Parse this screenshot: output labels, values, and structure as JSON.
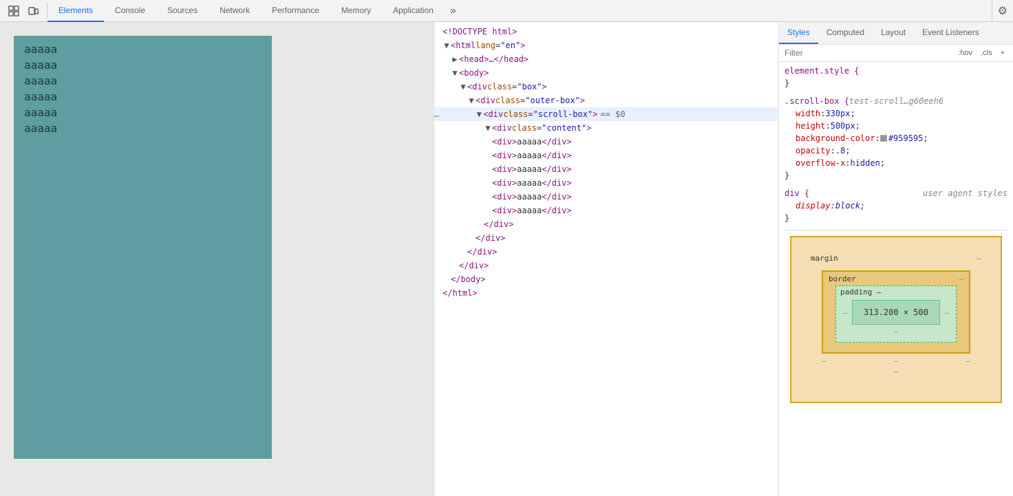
{
  "toolbar": {
    "inspect_icon": "⊹",
    "device_icon": "▭",
    "tabs": [
      {
        "id": "elements",
        "label": "Elements",
        "active": true
      },
      {
        "id": "console",
        "label": "Console",
        "active": false
      },
      {
        "id": "sources",
        "label": "Sources",
        "active": false
      },
      {
        "id": "network",
        "label": "Network",
        "active": false
      },
      {
        "id": "performance",
        "label": "Performance",
        "active": false
      },
      {
        "id": "memory",
        "label": "Memory",
        "active": false
      },
      {
        "id": "application",
        "label": "Application",
        "active": false
      }
    ],
    "overflow_icon": "»",
    "settings_icon": "⚙"
  },
  "preview": {
    "texts": [
      "aaaaa",
      "aaaaa",
      "aaaaa",
      "aaaaa",
      "aaaaa",
      "aaaaa"
    ]
  },
  "dom": {
    "lines": [
      {
        "indent": 0,
        "content": "<!DOCTYPE html>",
        "type": "doctype"
      },
      {
        "indent": 0,
        "content": "<html lang=\"en\">",
        "type": "open-tag",
        "hasTriangle": true,
        "triangleOpen": true
      },
      {
        "indent": 1,
        "content": "<head>…</head>",
        "type": "collapsed",
        "hasTriangle": true,
        "triangleOpen": false
      },
      {
        "indent": 1,
        "content": "<body>",
        "type": "open-tag",
        "hasTriangle": true,
        "triangleOpen": true
      },
      {
        "indent": 2,
        "content": "<div class=\"box\">",
        "type": "open-tag",
        "hasTriangle": true,
        "triangleOpen": true
      },
      {
        "indent": 3,
        "content": "<div class=\"outer-box\">",
        "type": "open-tag",
        "hasTriangle": true,
        "triangleOpen": true
      },
      {
        "indent": 4,
        "content": "<div class=\"scroll-box\"> == $0",
        "type": "selected",
        "hasTriangle": true,
        "triangleOpen": true,
        "hasEllipsis": true
      },
      {
        "indent": 5,
        "content": "<div class=\"content\">",
        "type": "open-tag",
        "hasTriangle": true,
        "triangleOpen": true
      },
      {
        "indent": 6,
        "content": "<div>aaaaa</div>",
        "type": "text-node"
      },
      {
        "indent": 6,
        "content": "<div>aaaaa</div>",
        "type": "text-node"
      },
      {
        "indent": 6,
        "content": "<div>aaaaa</div>",
        "type": "text-node"
      },
      {
        "indent": 6,
        "content": "<div>aaaaa</div>",
        "type": "text-node"
      },
      {
        "indent": 6,
        "content": "<div>aaaaa</div>",
        "type": "text-node"
      },
      {
        "indent": 6,
        "content": "<div>aaaaa</div>",
        "type": "text-node"
      },
      {
        "indent": 5,
        "content": "</div>",
        "type": "close-tag"
      },
      {
        "indent": 4,
        "content": "</div>",
        "type": "close-tag"
      },
      {
        "indent": 3,
        "content": "</div>",
        "type": "close-tag"
      },
      {
        "indent": 2,
        "content": "</div>",
        "type": "close-tag"
      },
      {
        "indent": 1,
        "content": "</body>",
        "type": "close-tag"
      },
      {
        "indent": 0,
        "content": "</html>",
        "type": "close-tag"
      }
    ]
  },
  "styles": {
    "tabs": [
      {
        "id": "styles",
        "label": "Styles",
        "active": true
      },
      {
        "id": "computed",
        "label": "Computed",
        "active": false
      },
      {
        "id": "layout",
        "label": "Layout",
        "active": false
      },
      {
        "id": "event-listeners",
        "label": "Event Listeners",
        "active": false
      }
    ],
    "filter": {
      "placeholder": "Filter",
      "hov_label": ":hov",
      "cls_label": ".cls",
      "plus_label": "+"
    },
    "rules": [
      {
        "selector": "element.style",
        "source": "",
        "properties": [],
        "openBrace": "{",
        "closeBrace": "}"
      },
      {
        "selector": ".scroll-box {",
        "source": "test-scroll…g60eeh6",
        "properties": [
          {
            "name": "width",
            "value": "330px",
            "hasColor": false
          },
          {
            "name": "height",
            "value": "500px",
            "hasColor": false
          },
          {
            "name": "background-color",
            "value": "#959595",
            "hasColor": true,
            "colorHex": "#959595"
          },
          {
            "name": "opacity",
            "value": ".8",
            "hasColor": false
          },
          {
            "name": "overflow-x",
            "value": "hidden",
            "hasColor": false
          }
        ]
      },
      {
        "selector": "div {",
        "source": "user agent styles",
        "properties": [
          {
            "name": "display",
            "value": "block",
            "hasColor": false
          }
        ]
      }
    ],
    "boxModel": {
      "title": "margin",
      "margin_dash": "–",
      "border_label": "border",
      "border_dash": "–",
      "padding_label": "padding –",
      "content": "313.200 × 500",
      "side_dash": "–"
    }
  }
}
